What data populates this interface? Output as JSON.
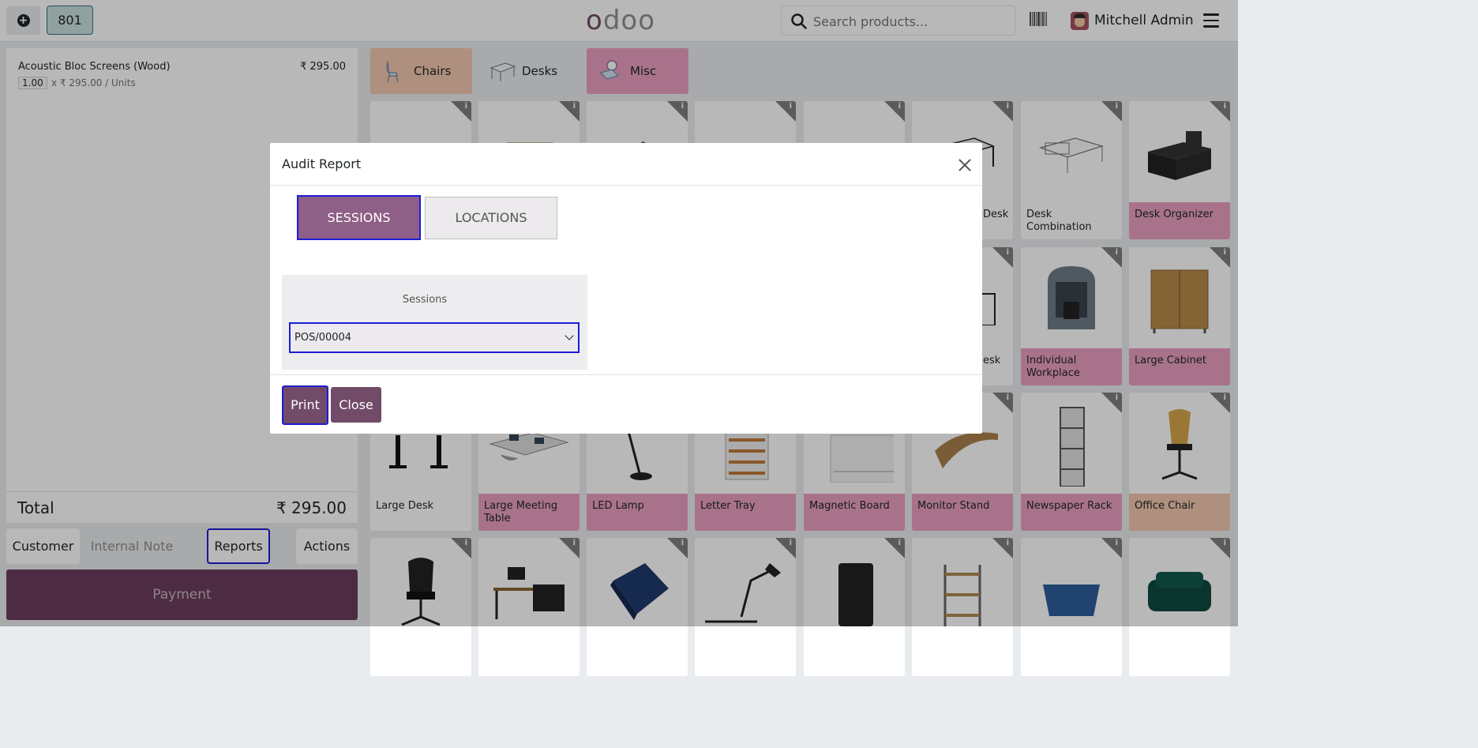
{
  "topbar": {
    "order_number": "801",
    "logo": "odoo",
    "search_placeholder": "Search products...",
    "user_name": "Mitchell Admin"
  },
  "order": {
    "line_name": "Acoustic Bloc Screens (Wood)",
    "line_price": "₹ 295.00",
    "line_qty": "1.00",
    "line_unit": "x ₹ 295.00 / Units",
    "total_label": "Total",
    "total_amount": "₹ 295.00"
  },
  "control_buttons": {
    "customer": "Customer",
    "internal_note": "Internal Note",
    "reports": "Reports",
    "actions": "Actions",
    "payment": "Payment"
  },
  "categories": [
    {
      "label": "Chairs",
      "color": "#f3c7ad"
    },
    {
      "label": "Desks",
      "color": "#e9ecef"
    },
    {
      "label": "Misc",
      "color": "#e9a0bf"
    }
  ],
  "products": {
    "row1": [
      "",
      "",
      "",
      "",
      "",
      "Desk",
      "Desk Combination",
      "Desk Organizer"
    ],
    "row2": [
      "",
      "",
      "",
      "",
      "",
      "esk",
      "Individual Workplace",
      "Large Cabinet"
    ],
    "row3": [
      "Large Desk",
      "Large Meeting Table",
      "LED Lamp",
      "Letter Tray",
      "Magnetic Board",
      "Monitor Stand",
      "Newspaper Rack",
      "Office Chair"
    ]
  },
  "modal": {
    "title": "Audit Report",
    "tab_sessions": "SESSIONS",
    "tab_locations": "LOCATIONS",
    "sessions_label": "Sessions",
    "selected_session": "POS/00004",
    "print": "Print",
    "close": "Close"
  },
  "colors": {
    "primary": "#714b67",
    "focus_outline": "#1d1dd6",
    "payment": "#6b3d5d"
  }
}
